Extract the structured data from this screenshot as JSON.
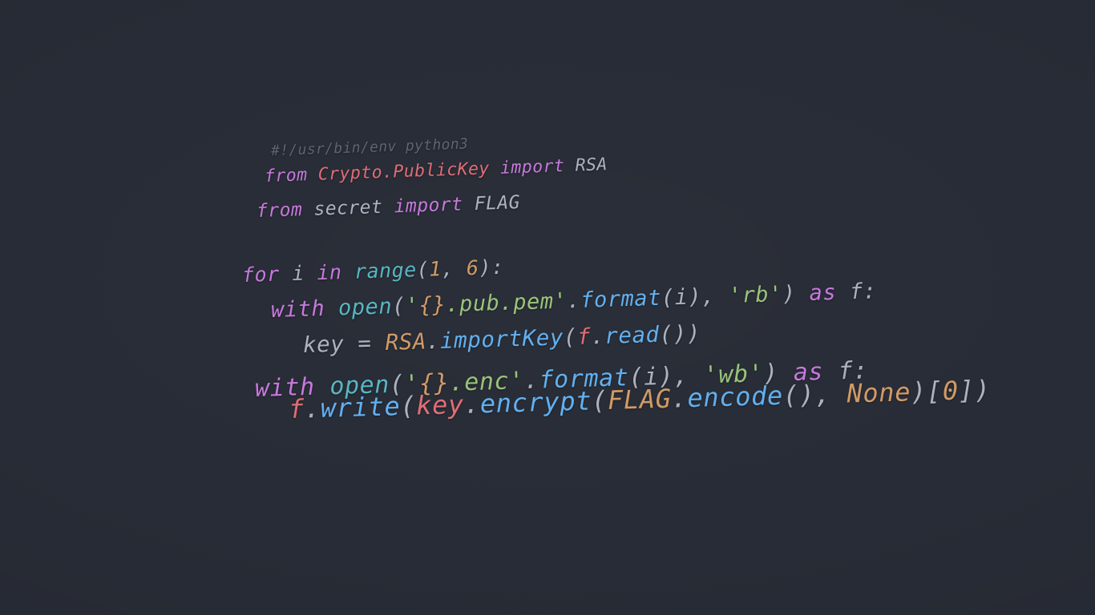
{
  "wallpaper": {
    "background_color": "#282c36",
    "language": "python",
    "theme": "one-dark"
  },
  "palette": {
    "background": "#282c36",
    "comment": "#5c6370",
    "keyword": "#c678dd",
    "class": "#e06c75",
    "variable": "#e06c75",
    "function": "#61afef",
    "builtin": "#56b6c2",
    "string": "#98c379",
    "number": "#d19a66",
    "constant": "#d19a66",
    "plain": "#abb2bf"
  },
  "code": {
    "lines": [
      {
        "index": 0,
        "text": "#!/usr/bin/env python3",
        "tokens": [
          {
            "t": "#!/usr/bin/env python3",
            "c": "tok-comment"
          }
        ]
      },
      {
        "index": 1,
        "text": "from Crypto.PublicKey import RSA",
        "tokens": [
          {
            "t": "from",
            "c": "tok-keyword"
          },
          {
            "t": " ",
            "c": "tok-plain"
          },
          {
            "t": "Crypto",
            "c": "tok-class"
          },
          {
            "t": ".",
            "c": "tok-class"
          },
          {
            "t": "PublicKey",
            "c": "tok-class"
          },
          {
            "t": " ",
            "c": "tok-plain"
          },
          {
            "t": "import",
            "c": "tok-keyword"
          },
          {
            "t": " ",
            "c": "tok-plain"
          },
          {
            "t": "RSA",
            "c": "tok-plain"
          }
        ]
      },
      {
        "index": 2,
        "text": "from secret import FLAG",
        "tokens": [
          {
            "t": "from",
            "c": "tok-keyword"
          },
          {
            "t": " ",
            "c": "tok-plain"
          },
          {
            "t": "secret",
            "c": "tok-plain"
          },
          {
            "t": " ",
            "c": "tok-plain"
          },
          {
            "t": "import",
            "c": "tok-keyword"
          },
          {
            "t": " ",
            "c": "tok-plain"
          },
          {
            "t": "FLAG",
            "c": "tok-plain"
          }
        ]
      },
      {
        "index": 3,
        "text": "for i in range(1, 6):",
        "tokens": [
          {
            "t": "for",
            "c": "tok-keyword"
          },
          {
            "t": " ",
            "c": "tok-plain"
          },
          {
            "t": "i",
            "c": "tok-plain"
          },
          {
            "t": " ",
            "c": "tok-plain"
          },
          {
            "t": "in",
            "c": "tok-keyword"
          },
          {
            "t": " ",
            "c": "tok-plain"
          },
          {
            "t": "range",
            "c": "tok-builtin"
          },
          {
            "t": "(",
            "c": "tok-punct"
          },
          {
            "t": "1",
            "c": "tok-number"
          },
          {
            "t": ", ",
            "c": "tok-punct"
          },
          {
            "t": "6",
            "c": "tok-number"
          },
          {
            "t": "):",
            "c": "tok-punct"
          }
        ]
      },
      {
        "index": 4,
        "text": "    with open('{}.pub.pem'.format(i), 'rb') as f:",
        "tokens": [
          {
            "t": "with",
            "c": "tok-keyword"
          },
          {
            "t": " ",
            "c": "tok-plain"
          },
          {
            "t": "open",
            "c": "tok-builtin"
          },
          {
            "t": "(",
            "c": "tok-punct"
          },
          {
            "t": "'",
            "c": "tok-string"
          },
          {
            "t": "{}",
            "c": "tok-fmt"
          },
          {
            "t": ".pub.pem",
            "c": "tok-string"
          },
          {
            "t": "'",
            "c": "tok-string"
          },
          {
            "t": ".",
            "c": "tok-punct"
          },
          {
            "t": "format",
            "c": "tok-func"
          },
          {
            "t": "(",
            "c": "tok-punct"
          },
          {
            "t": "i",
            "c": "tok-plain"
          },
          {
            "t": "), ",
            "c": "tok-punct"
          },
          {
            "t": "'rb'",
            "c": "tok-string"
          },
          {
            "t": ") ",
            "c": "tok-punct"
          },
          {
            "t": "as",
            "c": "tok-keyword"
          },
          {
            "t": " ",
            "c": "tok-plain"
          },
          {
            "t": "f",
            "c": "tok-plain"
          },
          {
            "t": ":",
            "c": "tok-punct"
          }
        ]
      },
      {
        "index": 5,
        "text": "        key = RSA.importKey(f.read())",
        "tokens": [
          {
            "t": "key",
            "c": "tok-plain"
          },
          {
            "t": " = ",
            "c": "tok-punct"
          },
          {
            "t": "RSA",
            "c": "tok-const"
          },
          {
            "t": ".",
            "c": "tok-punct"
          },
          {
            "t": "importKey",
            "c": "tok-func"
          },
          {
            "t": "(",
            "c": "tok-punct"
          },
          {
            "t": "f",
            "c": "tok-var"
          },
          {
            "t": ".",
            "c": "tok-punct"
          },
          {
            "t": "read",
            "c": "tok-func"
          },
          {
            "t": "())",
            "c": "tok-punct"
          }
        ]
      },
      {
        "index": 6,
        "text": "    with open('{}.enc'.format(i), 'wb') as f:",
        "tokens": [
          {
            "t": "with",
            "c": "tok-keyword"
          },
          {
            "t": " ",
            "c": "tok-plain"
          },
          {
            "t": "open",
            "c": "tok-builtin"
          },
          {
            "t": "(",
            "c": "tok-punct"
          },
          {
            "t": "'",
            "c": "tok-string"
          },
          {
            "t": "{}",
            "c": "tok-fmt"
          },
          {
            "t": ".enc",
            "c": "tok-string"
          },
          {
            "t": "'",
            "c": "tok-string"
          },
          {
            "t": ".",
            "c": "tok-punct"
          },
          {
            "t": "format",
            "c": "tok-func"
          },
          {
            "t": "(",
            "c": "tok-punct"
          },
          {
            "t": "i",
            "c": "tok-plain"
          },
          {
            "t": "), ",
            "c": "tok-punct"
          },
          {
            "t": "'wb'",
            "c": "tok-string"
          },
          {
            "t": ") ",
            "c": "tok-punct"
          },
          {
            "t": "as",
            "c": "tok-keyword"
          },
          {
            "t": " ",
            "c": "tok-plain"
          },
          {
            "t": "f",
            "c": "tok-plain"
          },
          {
            "t": ":",
            "c": "tok-punct"
          }
        ]
      },
      {
        "index": 7,
        "text": "        f.write(key.encrypt(FLAG.encode(), None)[0])",
        "tokens": [
          {
            "t": "f",
            "c": "tok-var"
          },
          {
            "t": ".",
            "c": "tok-punct"
          },
          {
            "t": "write",
            "c": "tok-func"
          },
          {
            "t": "(",
            "c": "tok-punct"
          },
          {
            "t": "key",
            "c": "tok-var"
          },
          {
            "t": ".",
            "c": "tok-punct"
          },
          {
            "t": "encrypt",
            "c": "tok-func"
          },
          {
            "t": "(",
            "c": "tok-punct"
          },
          {
            "t": "FLAG",
            "c": "tok-const"
          },
          {
            "t": ".",
            "c": "tok-punct"
          },
          {
            "t": "encode",
            "c": "tok-func"
          },
          {
            "t": "(), ",
            "c": "tok-punct"
          },
          {
            "t": "None",
            "c": "tok-const"
          },
          {
            "t": ")[",
            "c": "tok-punct"
          },
          {
            "t": "0",
            "c": "tok-number"
          },
          {
            "t": "])",
            "c": "tok-punct"
          }
        ]
      }
    ]
  }
}
